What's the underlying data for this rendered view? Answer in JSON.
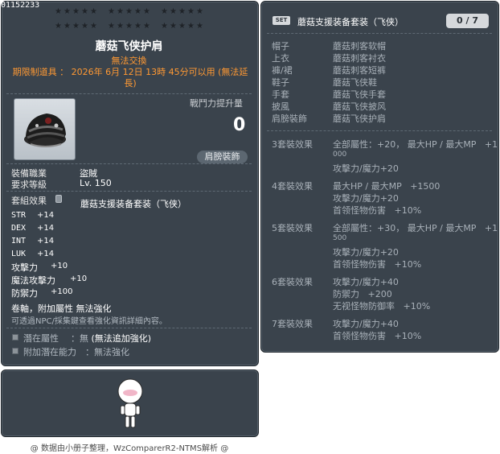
{
  "item": {
    "id": "01152233",
    "name": "蘑菇飞侠护肩",
    "untradeable": "無法交換",
    "expiry": "期限制道具 ： 2026年 6月 12日 13時 45分可以用 (無法延長)",
    "power_label": "戰鬥力提升量",
    "power_value": "0",
    "equip_slot": "肩膀裝飾",
    "job_label": "裝備職業",
    "job_value": "盜賊",
    "req_label": "要求等級",
    "req_value": "Lv. 150",
    "set_label": "套組效果",
    "set_name": "蘑菇支援装备套装（飞侠）",
    "stats": [
      {
        "label": "STR",
        "value": "+14"
      },
      {
        "label": "DEX",
        "value": "+14"
      },
      {
        "label": "INT",
        "value": "+14"
      },
      {
        "label": "LUK",
        "value": "+14"
      },
      {
        "label": "攻擊力",
        "value": "+10"
      },
      {
        "label": "魔法攻擊力",
        "value": "+10"
      },
      {
        "label": "防禦力",
        "value": "+100"
      }
    ],
    "scroll_note": "卷軸，附加屬性 無法強化",
    "npc_note": "可透過NPC/採集鍵查看強化資訊詳細內容。",
    "potential_label": "潛在屬性",
    "potential_value": "：無",
    "potential_value_extra": "(無法追加強化)",
    "bonus_potential_label": "附加潛在能力",
    "bonus_potential_value": "：無法強化"
  },
  "footer": "@ 数据由小册子整理，WzComparerR2-NTMS解析 @",
  "set": {
    "badge": "SET",
    "title": "蘑菇支援装备套装（飞侠）",
    "count": "0 / 7",
    "slots": [
      {
        "slot": "帽子",
        "item": "蘑菇刺客软帽"
      },
      {
        "slot": "上衣",
        "item": "蘑菇刺客衬衣"
      },
      {
        "slot": "褲/裙",
        "item": "蘑菇刺客短裤"
      },
      {
        "slot": "鞋子",
        "item": "蘑菇飞侠鞋"
      },
      {
        "slot": "手套",
        "item": "蘑菇飞侠手套"
      },
      {
        "slot": "披風",
        "item": "蘑菇飞侠披风"
      },
      {
        "slot": "肩膀裝飾",
        "item": "蘑菇飞侠护肩"
      }
    ],
    "bonuses": [
      {
        "title": "3套裝效果",
        "lines": [
          "全部屬性：+20， 最大HP / 最大MP   +1",
          "000",
          "攻擊力/魔力+20"
        ]
      },
      {
        "title": "4套裝效果",
        "lines": [
          "最大HP / 最大MP   +1500",
          "攻擊力/魔力+20",
          "首领怪物伤害   +10%"
        ]
      },
      {
        "title": "5套裝效果",
        "lines": [
          "全部屬性：+30， 最大HP / 最大MP   +1",
          "500",
          "攻擊力/魔力+20",
          "首领怪物伤害   +10%"
        ]
      },
      {
        "title": "6套裝效果",
        "lines": [
          "攻擊力/魔力+40",
          "防禦力   +200",
          "无视怪物防御率   +10%"
        ]
      },
      {
        "title": "7套裝效果",
        "lines": [
          "攻擊力/魔力+40",
          "首领怪物伤害   +10%"
        ]
      }
    ]
  }
}
